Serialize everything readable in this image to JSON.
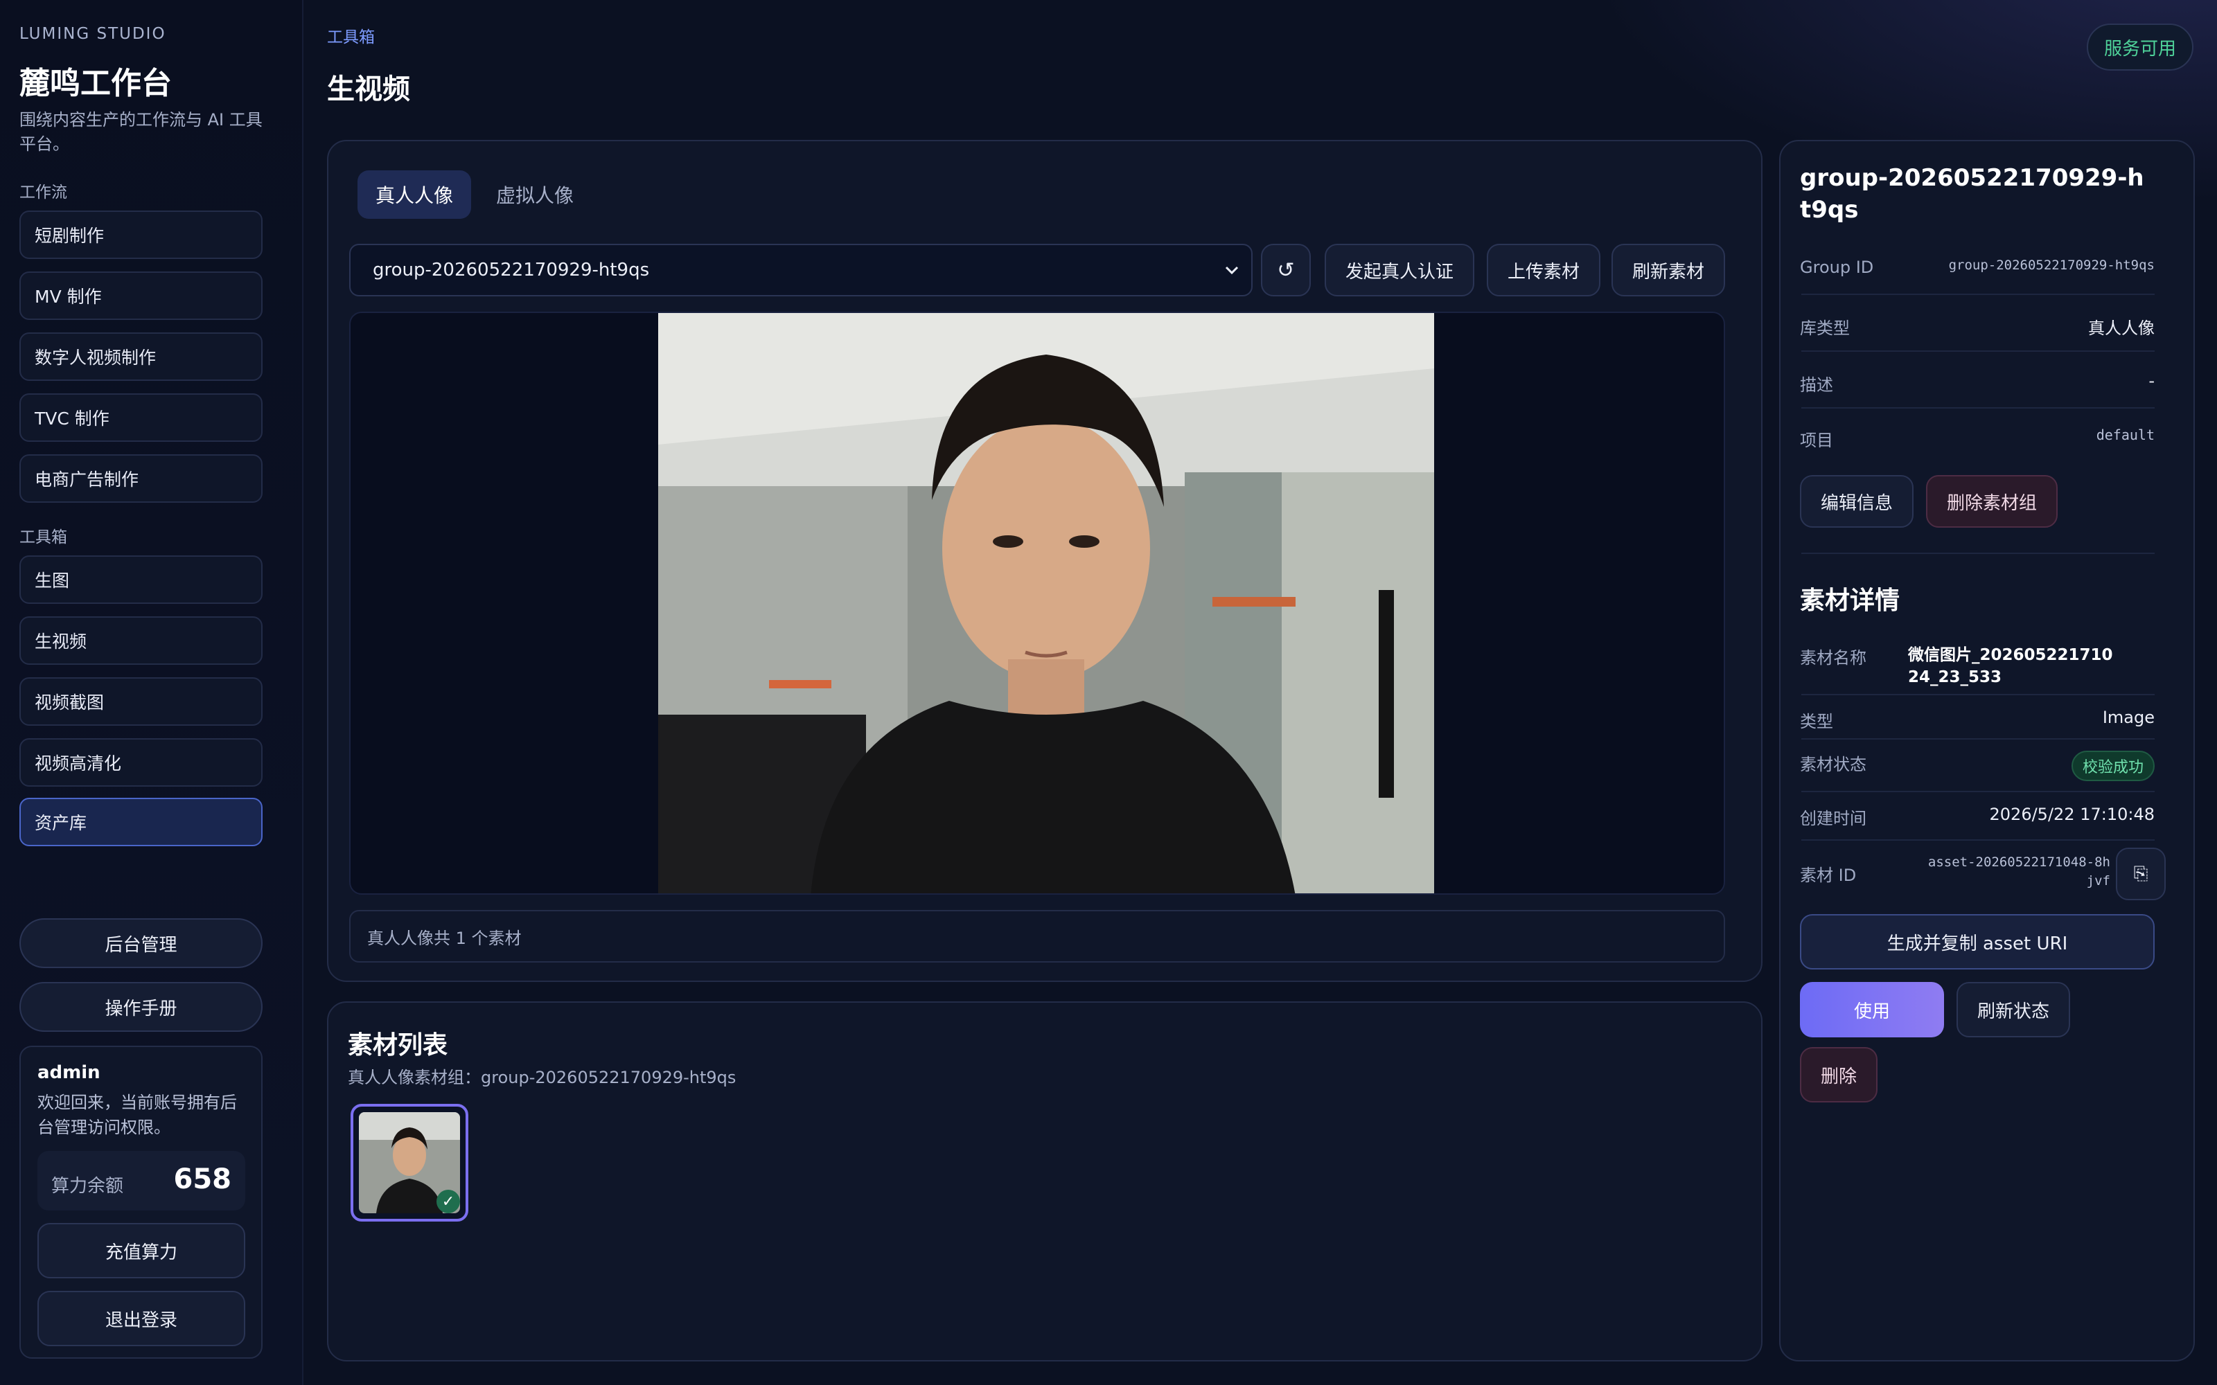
{
  "sidebar": {
    "brand_en": "LUMING STUDIO",
    "brand_cn": "麓鸣工作台",
    "brand_desc": "围绕内容生产的工作流与 AI 工具平台。",
    "workflow_label": "工作流",
    "workflow_items": [
      "短剧制作",
      "MV 制作",
      "数字人视频制作",
      "TVC 制作",
      "电商广告制作"
    ],
    "toolbox_label": "工具箱",
    "toolbox_items": [
      "生图",
      "生视频",
      "视频截图",
      "视频高清化",
      "资产库"
    ],
    "active_item": "资产库",
    "admin_button": "后台管理",
    "manual_button": "操作手册",
    "user": {
      "name": "admin",
      "welcome": "欢迎回来，当前账号拥有后台管理访问权限。",
      "balance_label": "算力余额",
      "balance_value": "658",
      "recharge_button": "充值算力",
      "logout_button": "退出登录"
    }
  },
  "header": {
    "breadcrumb": "工具箱",
    "title": "生视频",
    "service_status": "服务可用"
  },
  "viewer": {
    "tabs": [
      "真人人像",
      "虚拟人像"
    ],
    "active_tab": "真人人像",
    "group_select_value": "group-20260522170929-ht9qs",
    "reset_icon": "↺",
    "actions": [
      "发起真人认证",
      "上传素材",
      "刷新素材"
    ],
    "footer_text": "真人人像共 1 个素材"
  },
  "asset_list": {
    "title": "素材列表",
    "subtitle": "真人人像素材组：group-20260522170929-ht9qs",
    "check_icon": "✓"
  },
  "details": {
    "group_title": "group-20260522170929-ht9qs",
    "group_rows": [
      {
        "key": "Group ID",
        "value": "group-20260522170929-ht9qs"
      },
      {
        "key": "库类型",
        "value": "真人人像"
      },
      {
        "key": "描述",
        "value": "-"
      },
      {
        "key": "项目",
        "value": "default"
      }
    ],
    "edit_button": "编辑信息",
    "delete_group_button": "删除素材组",
    "asset_title": "素材详情",
    "asset_name_label": "素材名称",
    "asset_name_value": "微信图片_20260522171024_23_533",
    "type_label": "类型",
    "type_value": "Image",
    "status_label": "素材状态",
    "status_value": "校验成功",
    "created_label": "创建时间",
    "created_value": "2026/5/22 17:10:48",
    "asset_id_label": "素材 ID",
    "asset_id_value": "asset-20260522171048-8hjvf",
    "copy_icon": "⎘",
    "generate_uri_button": "生成并复制 asset URI",
    "use_button": "使用",
    "refresh_status_button": "刷新状态",
    "delete_button": "删除"
  },
  "colors": {
    "accent_purple": "#7b6ff0",
    "success_green": "#4fd39a",
    "active_nav": "#4a65c9"
  }
}
